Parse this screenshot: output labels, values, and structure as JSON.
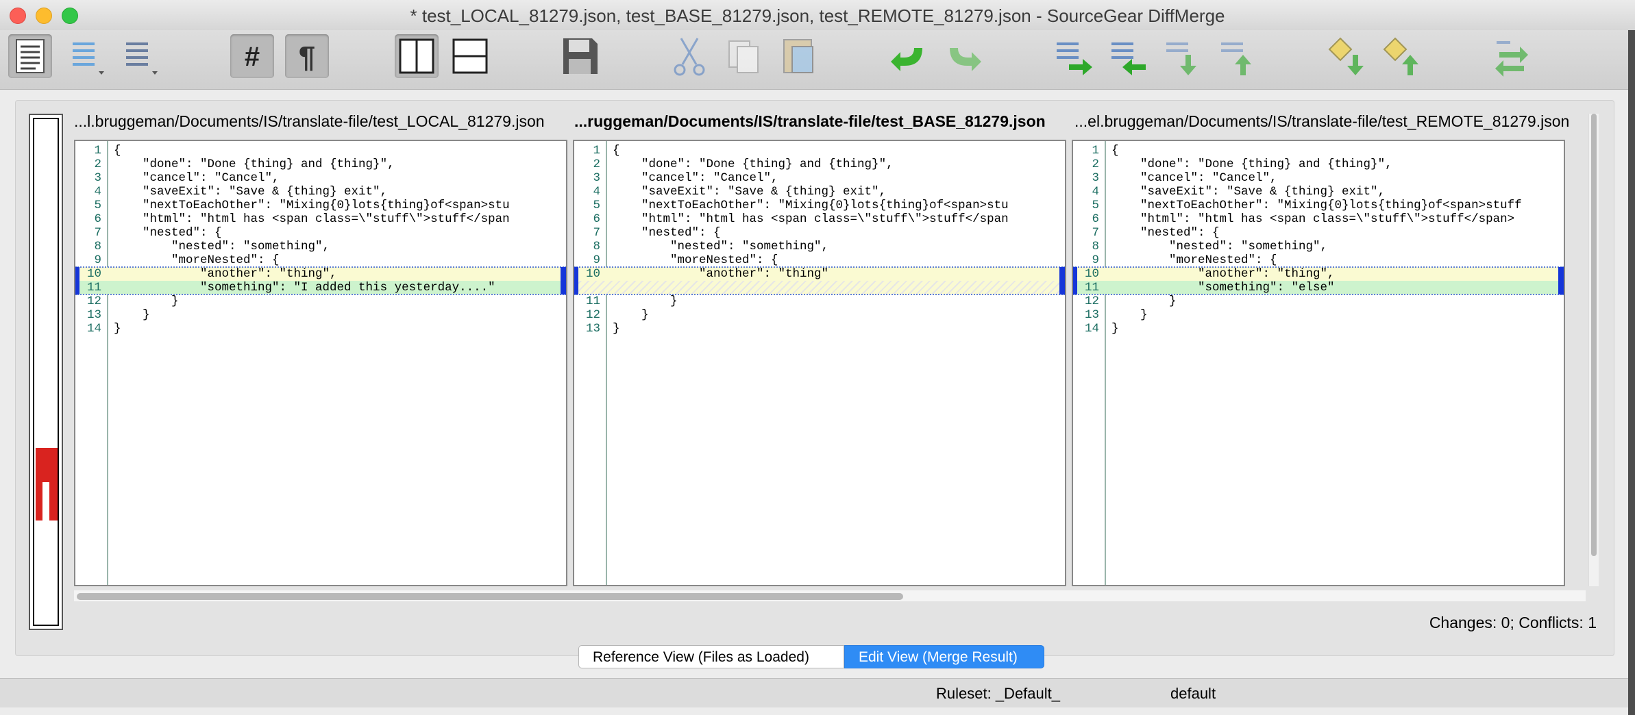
{
  "window": {
    "title": "* test_LOCAL_81279.json, test_BASE_81279.json, test_REMOTE_81279.json - SourceGear DiffMerge",
    "traffic_colors": {
      "close": "#fc5f57",
      "minimize": "#fdbc2e",
      "zoom": "#33c748"
    }
  },
  "toolbar": {
    "buttons": [
      {
        "name": "file-list-icon",
        "pressed": true
      },
      {
        "name": "file-list-blue-icon",
        "pressed": false
      },
      {
        "name": "file-list-menu-icon",
        "pressed": false
      },
      {
        "name": "line-numbers-icon",
        "pressed": true
      },
      {
        "name": "pilcrow-icon",
        "pressed": true
      },
      {
        "name": "side-by-side-icon",
        "pressed": true
      },
      {
        "name": "stacked-view-icon",
        "pressed": false
      },
      {
        "name": "save-icon",
        "pressed": false
      },
      {
        "name": "cut-icon",
        "pressed": false
      },
      {
        "name": "copy-icon",
        "pressed": false
      },
      {
        "name": "paste-icon",
        "pressed": false
      },
      {
        "name": "undo-icon",
        "pressed": false
      },
      {
        "name": "redo-icon",
        "pressed": false
      },
      {
        "name": "apply-right-icon",
        "pressed": false
      },
      {
        "name": "apply-left-icon",
        "pressed": false
      },
      {
        "name": "next-change-icon",
        "pressed": false
      },
      {
        "name": "previous-change-icon",
        "pressed": false
      },
      {
        "name": "next-conflict-icon",
        "pressed": false
      },
      {
        "name": "previous-conflict-icon",
        "pressed": false
      },
      {
        "name": "sync-icon",
        "pressed": false
      }
    ]
  },
  "panes": [
    {
      "header": "...l.bruggeman/Documents/IS/translate-file/test_LOCAL_81279.json",
      "bold": false,
      "lines": [
        {
          "n": "1",
          "text": "{"
        },
        {
          "n": "2",
          "text": "    \"done\": \"Done {thing} and {thing}\","
        },
        {
          "n": "3",
          "text": "    \"cancel\": \"Cancel\","
        },
        {
          "n": "4",
          "text": "    \"saveExit\": \"Save & {thing} exit\","
        },
        {
          "n": "5",
          "text": "    \"nextToEachOther\": \"Mixing{0}lots{thing}of<span>stu"
        },
        {
          "n": "6",
          "text": "    \"html\": \"html has <span class=\\\"stuff\\\">stuff</span"
        },
        {
          "n": "7",
          "text": "    \"nested\": {"
        },
        {
          "n": "8",
          "text": "        \"nested\": \"something\","
        },
        {
          "n": "9",
          "text": "        \"moreNested\": {"
        },
        {
          "n": "10",
          "text": "            \"another\": \"thing\",",
          "hl": "y"
        },
        {
          "n": "11",
          "text": "            \"something\": \"I added this yesterday....\"",
          "hl": "g"
        },
        {
          "n": "12",
          "text": "        }"
        },
        {
          "n": "13",
          "text": "    }"
        },
        {
          "n": "14",
          "text": "}"
        }
      ]
    },
    {
      "header": "...ruggeman/Documents/IS/translate-file/test_BASE_81279.json",
      "bold": true,
      "lines": [
        {
          "n": "1",
          "text": "{"
        },
        {
          "n": "2",
          "text": "    \"done\": \"Done {thing} and {thing}\","
        },
        {
          "n": "3",
          "text": "    \"cancel\": \"Cancel\","
        },
        {
          "n": "4",
          "text": "    \"saveExit\": \"Save & {thing} exit\","
        },
        {
          "n": "5",
          "text": "    \"nextToEachOther\": \"Mixing{0}lots{thing}of<span>stu"
        },
        {
          "n": "6",
          "text": "    \"html\": \"html has <span class=\\\"stuff\\\">stuff</span"
        },
        {
          "n": "7",
          "text": "    \"nested\": {"
        },
        {
          "n": "8",
          "text": "        \"nested\": \"something\","
        },
        {
          "n": "9",
          "text": "        \"moreNested\": {"
        },
        {
          "n": "10",
          "text": "            \"another\": \"thing\"",
          "hl": "y"
        },
        {
          "n": "",
          "text": "",
          "hl": "hatch"
        },
        {
          "n": "11",
          "text": "        }"
        },
        {
          "n": "12",
          "text": "    }"
        },
        {
          "n": "13",
          "text": "}"
        }
      ]
    },
    {
      "header": "...el.bruggeman/Documents/IS/translate-file/test_REMOTE_81279.json",
      "bold": false,
      "lines": [
        {
          "n": "1",
          "text": "{"
        },
        {
          "n": "2",
          "text": "    \"done\": \"Done {thing} and {thing}\","
        },
        {
          "n": "3",
          "text": "    \"cancel\": \"Cancel\","
        },
        {
          "n": "4",
          "text": "    \"saveExit\": \"Save & {thing} exit\","
        },
        {
          "n": "5",
          "text": "    \"nextToEachOther\": \"Mixing{0}lots{thing}of<span>stuff"
        },
        {
          "n": "6",
          "text": "    \"html\": \"html has <span class=\\\"stuff\\\">stuff</span>"
        },
        {
          "n": "7",
          "text": "    \"nested\": {"
        },
        {
          "n": "8",
          "text": "        \"nested\": \"something\","
        },
        {
          "n": "9",
          "text": "        \"moreNested\": {"
        },
        {
          "n": "10",
          "text": "            \"another\": \"thing\",",
          "hl": "y"
        },
        {
          "n": "11",
          "text": "            \"something\": \"else\"",
          "hl": "g"
        },
        {
          "n": "12",
          "text": "        }"
        },
        {
          "n": "13",
          "text": "    }"
        },
        {
          "n": "14",
          "text": "}"
        }
      ]
    }
  ],
  "status": "Changes: 0; Conflicts: 1",
  "tabs": {
    "reference": "Reference View (Files as Loaded)",
    "edit": "Edit View (Merge Result)"
  },
  "bottom": {
    "ruleset": "Ruleset: _Default_",
    "encoding": "default"
  },
  "colors": {
    "conflict_marker": "#1535d9",
    "change_yellow": "#fafad2",
    "change_green": "#cdf3cd",
    "overview_red": "#d9231f"
  }
}
